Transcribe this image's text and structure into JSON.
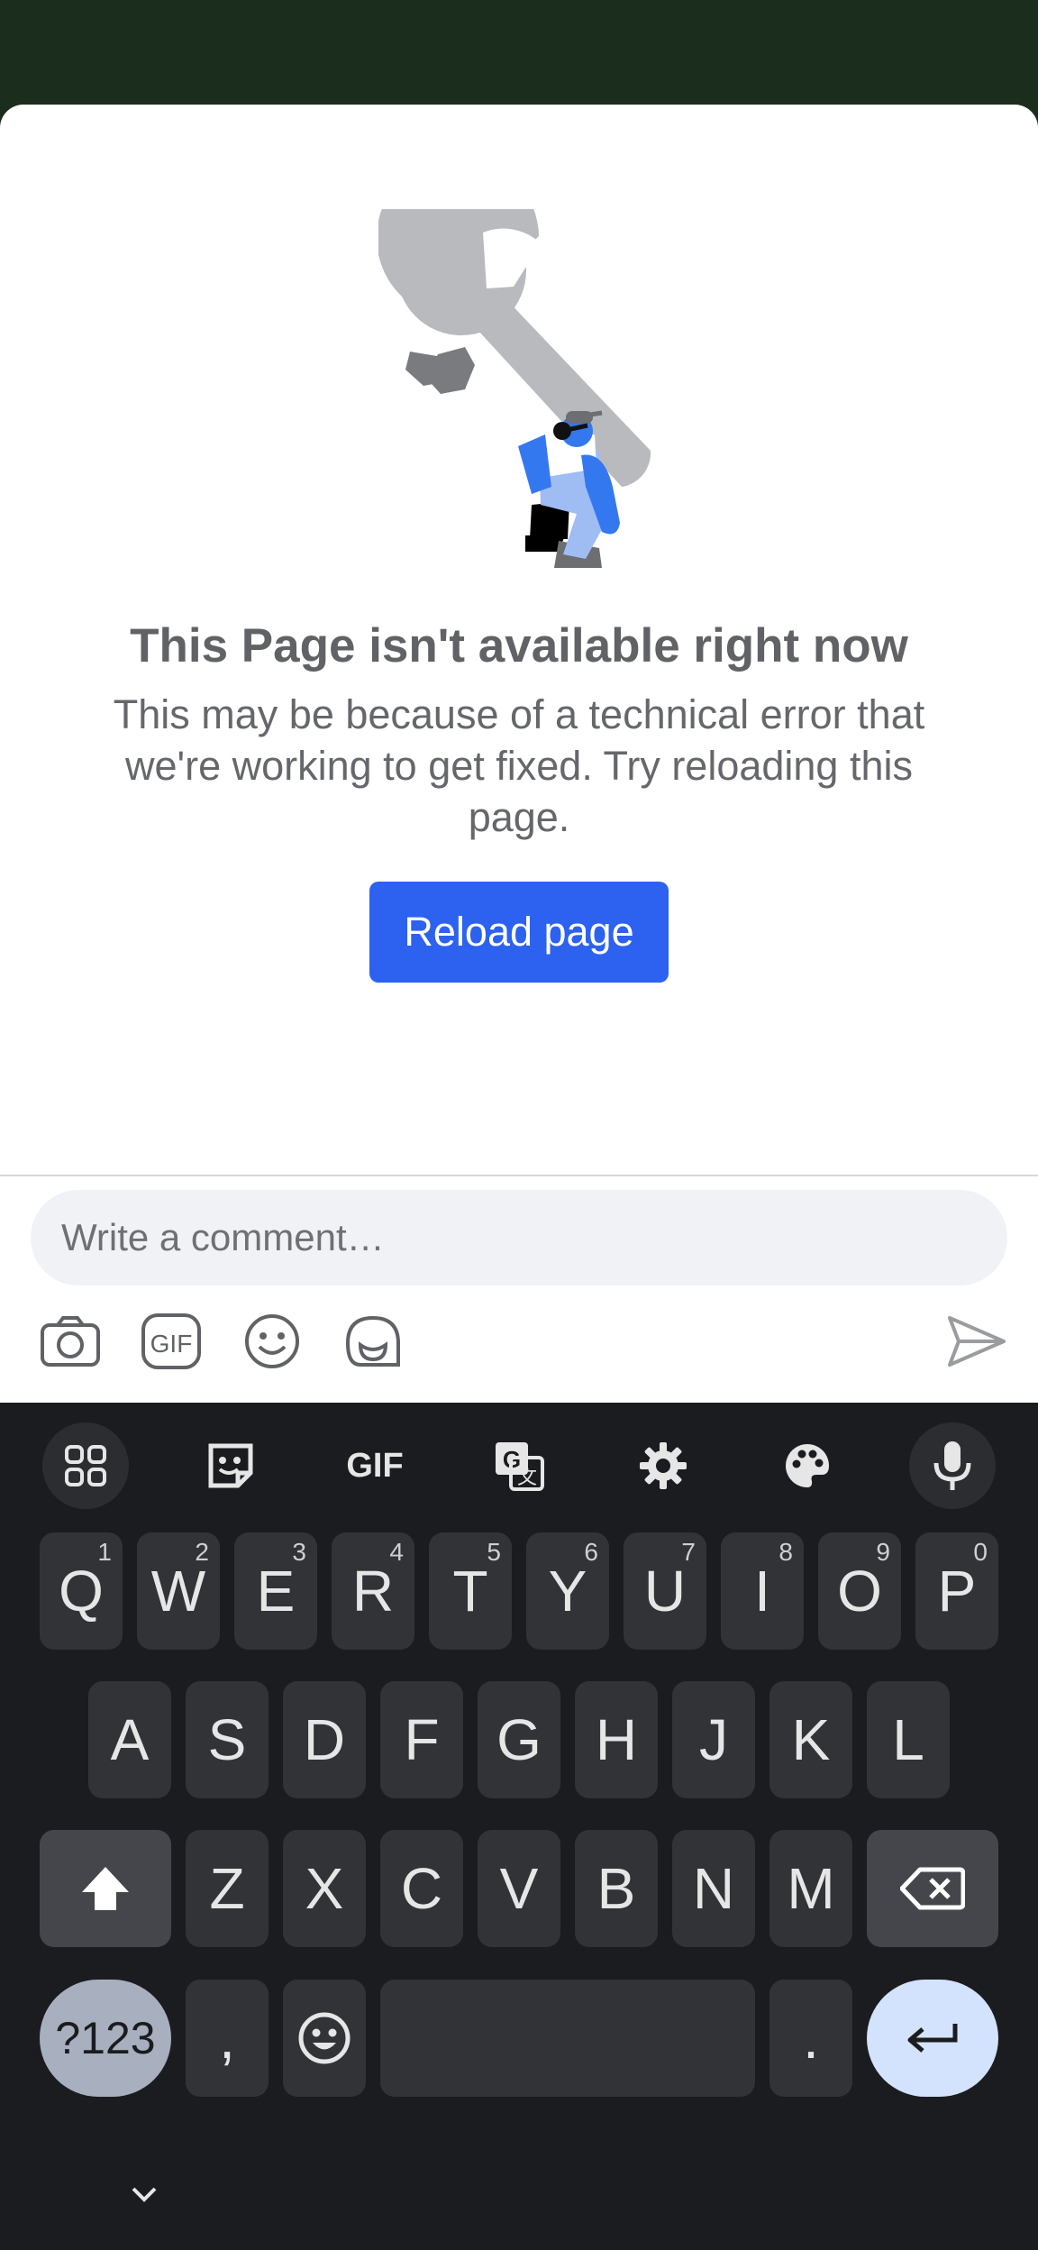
{
  "error_page": {
    "title": "This Page isn't available right now",
    "message": "This may be because of a technical error that we're working to get fixed. Try reloading this page.",
    "reload_label": "Reload page"
  },
  "composer": {
    "placeholder": "Write a comment…",
    "tools": [
      "camera-icon",
      "gif-icon",
      "emoji-icon",
      "avatar-sticker-icon"
    ],
    "send_icon": "send-icon"
  },
  "keyboard": {
    "toolbar": [
      "apps-grid-icon",
      "sticker-icon",
      "gif-icon",
      "translate-icon",
      "settings-icon",
      "theme-palette-icon",
      "microphone-icon"
    ],
    "gif_label": "GIF",
    "row1": [
      {
        "k": "Q",
        "n": "1"
      },
      {
        "k": "W",
        "n": "2"
      },
      {
        "k": "E",
        "n": "3"
      },
      {
        "k": "R",
        "n": "4"
      },
      {
        "k": "T",
        "n": "5"
      },
      {
        "k": "Y",
        "n": "6"
      },
      {
        "k": "U",
        "n": "7"
      },
      {
        "k": "I",
        "n": "8"
      },
      {
        "k": "O",
        "n": "9"
      },
      {
        "k": "P",
        "n": "0"
      }
    ],
    "row2": [
      "A",
      "S",
      "D",
      "F",
      "G",
      "H",
      "J",
      "K",
      "L"
    ],
    "row3": [
      "Z",
      "X",
      "C",
      "V",
      "B",
      "N",
      "M"
    ],
    "symbols_label": "?123",
    "comma": ",",
    "period": ".",
    "colors": {
      "key": "#323337",
      "action": "#45464b",
      "enter": "#d3e3fd",
      "symbols": "#a8b0bf"
    }
  }
}
